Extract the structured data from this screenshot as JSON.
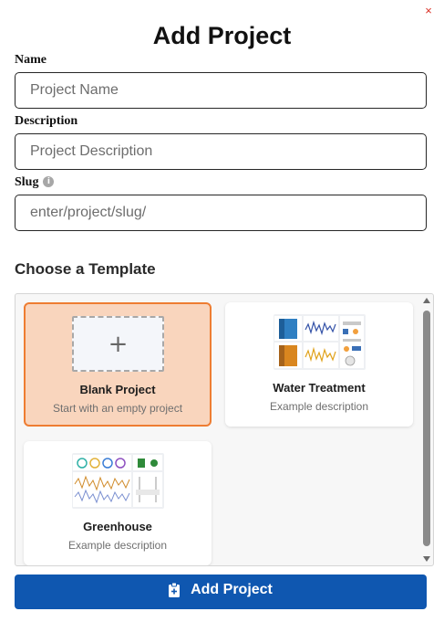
{
  "dialog": {
    "title": "Add Project",
    "close_glyph": "×"
  },
  "form": {
    "name": {
      "label": "Name",
      "placeholder": "Project Name",
      "value": ""
    },
    "description": {
      "label": "Description",
      "placeholder": "Project Description",
      "value": ""
    },
    "slug": {
      "label": "Slug",
      "placeholder": "enter/project/slug/",
      "value": "",
      "info_icon": "info-icon",
      "info_glyph": "i"
    }
  },
  "templates": {
    "heading": "Choose a Template",
    "items": [
      {
        "name": "Blank Project",
        "description": "Start with an empty project",
        "selected": true,
        "thumb_icon": "plus-icon",
        "thumb_glyph": "+"
      },
      {
        "name": "Water Treatment",
        "description": "Example description",
        "selected": false,
        "thumb_icon": "dashboard-thumbnail"
      },
      {
        "name": "Greenhouse",
        "description": "Example description",
        "selected": false,
        "thumb_icon": "dashboard-thumbnail"
      }
    ]
  },
  "submit": {
    "label": "Add Project",
    "icon": "clipboard-add-icon"
  },
  "colors": {
    "primary": "#0f57b0",
    "selected_bg": "#f9d5bd",
    "selected_border": "#ee7d32",
    "close": "#d93025"
  }
}
